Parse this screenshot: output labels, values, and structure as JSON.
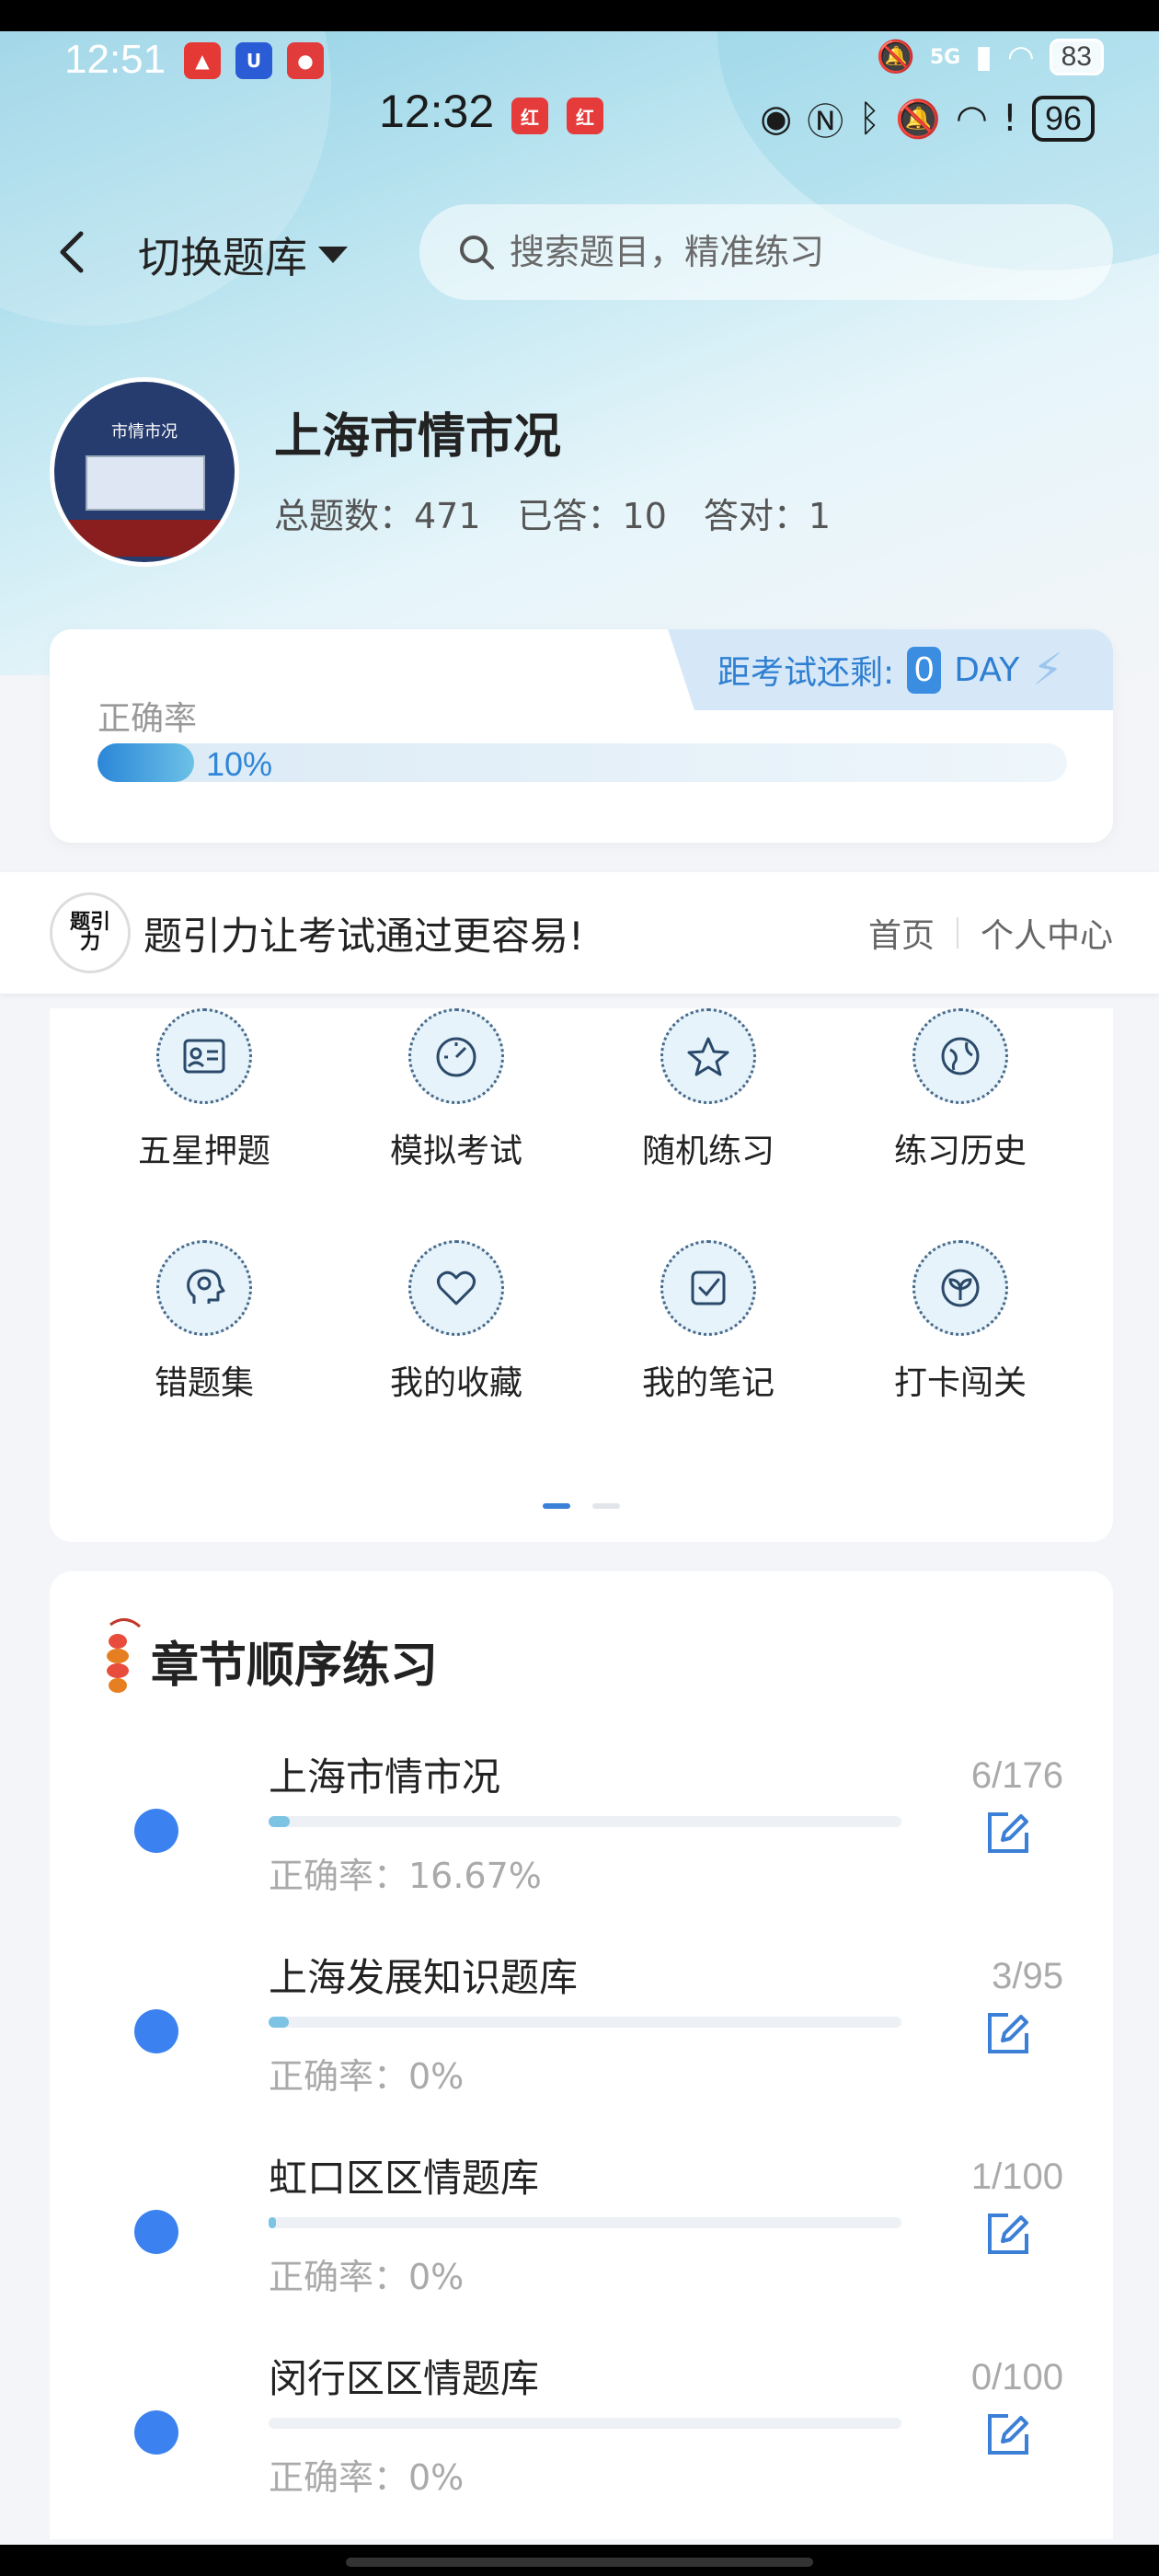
{
  "status_outer": {
    "time": "12:51",
    "signal": "5G",
    "battery": "83"
  },
  "status_inner": {
    "time": "12:32",
    "battery": "96"
  },
  "nav": {
    "switch_label": "切换题库",
    "search_placeholder": "搜索题目，精准练习"
  },
  "profile": {
    "avatar_caption": "市情市况",
    "title": "上海市情市况",
    "total_label": "总题数：471",
    "answered_label": "已答：10",
    "correct_label": "答对：1"
  },
  "countdown": {
    "prefix": "距考试还剩:",
    "value": "0",
    "unit": "DAY"
  },
  "accuracy": {
    "label": "正确率",
    "value_text": "10%",
    "value": 0.1
  },
  "banner": {
    "logo_text": "题引力",
    "slogan": "题引力让考试通过更容易!",
    "home": "首页",
    "personal": "个人中心"
  },
  "grid": [
    {
      "label": "五星押题",
      "icon": "id-card-icon"
    },
    {
      "label": "模拟考试",
      "icon": "gauge-icon"
    },
    {
      "label": "随机练习",
      "icon": "shuffle-star-icon"
    },
    {
      "label": "练习历史",
      "icon": "globe-history-icon"
    },
    {
      "label": "错题集",
      "icon": "head-icon"
    },
    {
      "label": "我的收藏",
      "icon": "heart-icon"
    },
    {
      "label": "我的笔记",
      "icon": "checkbox-icon"
    },
    {
      "label": "打卡闯关",
      "icon": "sprout-icon"
    }
  ],
  "chapters": {
    "title": "章节顺序练习",
    "items": [
      {
        "name": "上海市情市况",
        "accuracy": "正确率：16.67%",
        "count": "6/176",
        "progress": 0.034
      },
      {
        "name": "上海发展知识题库",
        "accuracy": "正确率：0%",
        "count": "3/95",
        "progress": 0.032
      },
      {
        "name": "虹口区区情题库",
        "accuracy": "正确率：0%",
        "count": "1/100",
        "progress": 0.01
      },
      {
        "name": "闵行区区情题库",
        "accuracy": "正确率：0%",
        "count": "0/100",
        "progress": 0.0
      }
    ]
  },
  "colors": {
    "accent": "#3b82f0",
    "progress": "#7cc3e4",
    "countdown_bg": "#d6e8f8"
  }
}
